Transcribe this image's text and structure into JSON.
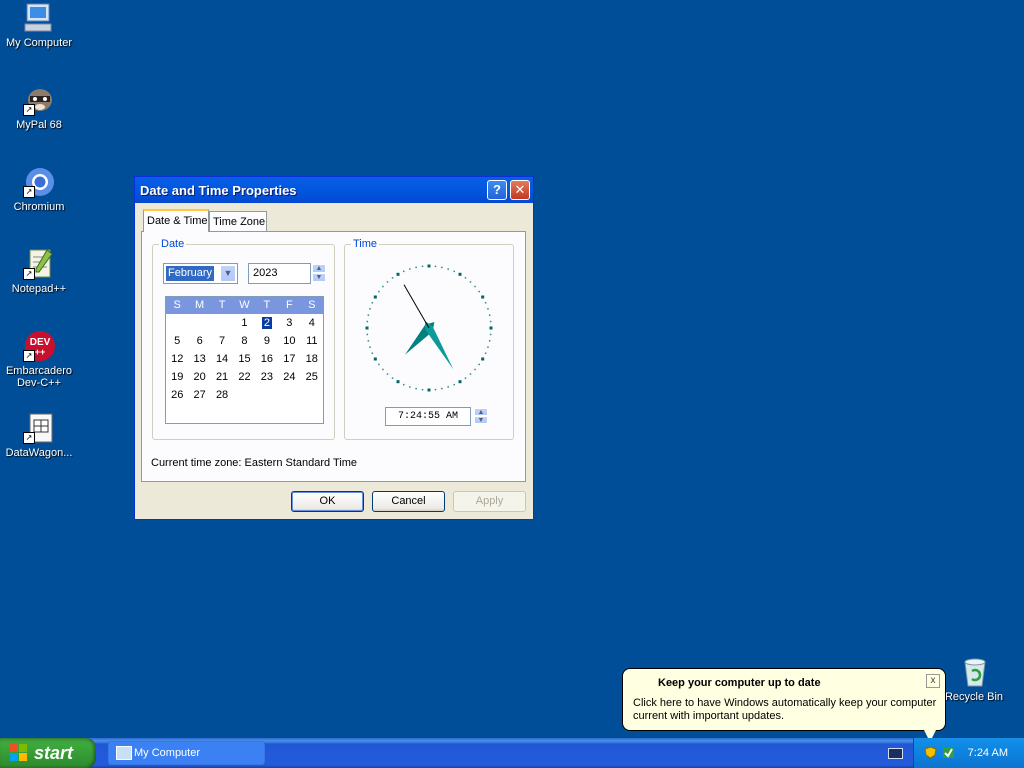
{
  "desktop": {
    "icons": [
      {
        "label": "My Computer"
      },
      {
        "label": "MyPal 68"
      },
      {
        "label": "Chromium"
      },
      {
        "label": "Notepad++"
      },
      {
        "label": "Embarcadero\nDev-C++"
      },
      {
        "label": "DataWagon..."
      },
      {
        "label": "Recycle Bin"
      }
    ]
  },
  "dialog": {
    "title": "Date and Time Properties",
    "help_glyph": "?",
    "close_glyph": "✕",
    "tabs": [
      "Date & Time",
      "Time Zone"
    ],
    "date_group": {
      "title": "Date",
      "month": "February",
      "year": "2023",
      "weekday_headers": [
        "S",
        "M",
        "T",
        "W",
        "T",
        "F",
        "S"
      ],
      "days": [
        "",
        "",
        "",
        "1",
        "2",
        "3",
        "4",
        "5",
        "6",
        "7",
        "8",
        "9",
        "10",
        "11",
        "12",
        "13",
        "14",
        "15",
        "16",
        "17",
        "18",
        "19",
        "20",
        "21",
        "22",
        "23",
        "24",
        "25",
        "26",
        "27",
        "28"
      ],
      "selected_day": "2"
    },
    "time_group": {
      "title": "Time",
      "time_value": "7:24:55 AM",
      "clock": {
        "hour": 7,
        "minute": 24,
        "second": 55
      }
    },
    "timezone_text": "Current time zone:  Eastern Standard Time",
    "buttons": {
      "ok": "OK",
      "cancel": "Cancel",
      "apply": "Apply"
    }
  },
  "taskbar": {
    "start_label": "start",
    "task_items": [
      "My Computer"
    ],
    "clock": "7:24 AM"
  },
  "balloon": {
    "title": "Keep your computer up to date",
    "text": "Click here to have Windows automatically keep your computer current with important updates.",
    "close_glyph": "x"
  },
  "colors": {
    "desktop": "#004E98",
    "titlebar": "#0358E0",
    "calendar_header": "#7A96DF",
    "clock_hands": "#008080"
  }
}
